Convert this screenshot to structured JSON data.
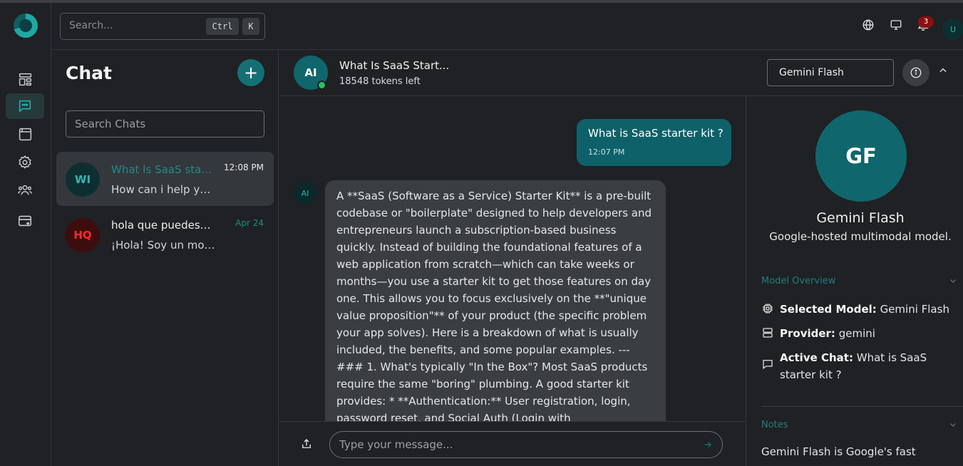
{
  "app": {
    "topbar": {
      "search_placeholder": "Search...",
      "shortcut_ctrl": "Ctrl",
      "shortcut_key": "K",
      "notification_count": "3",
      "user_initial": "U"
    },
    "rail": {
      "icons": [
        "dashboard-icon",
        "chat-icon",
        "browser-icon",
        "settings-icon",
        "users-icon",
        "billing-icon"
      ],
      "active": "chat-icon"
    },
    "chat_list": {
      "title": "Chat",
      "new_chat_label": "+",
      "search_placeholder": "Search Chats",
      "items": [
        {
          "initials": "WI",
          "title": "What Is SaaS starter kit",
          "preview": "How can i help you today?",
          "time": "12:08 PM",
          "avatar_bg": "#0d2f32",
          "avatar_fg": "#2fb7ae",
          "title_color": "#1f8b86",
          "time_color": "#ecedef"
        },
        {
          "initials": "HQ",
          "title": "hola que puedes hacer",
          "preview": "¡Hola! Soy un modelo de lenguaje",
          "time": "Apr 24",
          "avatar_bg": "#3d0d0d",
          "avatar_fg": "#ff2a2a",
          "title_color": "#eceef0",
          "time_color": "#1f8b86"
        }
      ]
    },
    "conversation": {
      "avatar": "AI",
      "title": "What Is SaaS Start...",
      "tokens_left": "18548 tokens left",
      "model_selected": "Gemini Flash",
      "messages": {
        "user": {
          "text": "What is SaaS starter kit ?",
          "time": "12:07 PM"
        },
        "ai_avatar": "AI",
        "ai_text": "A **SaaS (Software as a Service) Starter Kit** is a pre-built codebase or \"boilerplate\" designed to help developers and entrepreneurs launch a subscription-based business quickly. Instead of building the foundational features of a web application from scratch—which can take weeks or months—you use a starter kit to get those features on day one. This allows you to focus exclusively on the **\"unique value proposition\"** of your product (the specific problem your app solves). Here is a breakdown of what is usually included, the benefits, and some popular examples. --- ### 1. What's typically \"In the Box\"? Most SaaS products require the same \"boring\" plumbing. A good starter kit provides: * **Authentication:** User registration, login, password reset, and Social Auth (Login with Google/GitHub)."
      },
      "composer_placeholder": "Type your message..."
    },
    "model_panel": {
      "initials": "GF",
      "name": "Gemini Flash",
      "description": "Google-hosted multimodal model.",
      "overview_title": "Model Overview",
      "selected_model_label": "Selected Model:",
      "selected_model_value": "Gemini Flash",
      "provider_label": "Provider:",
      "provider_value": "gemini",
      "active_chat_label": "Active Chat:",
      "active_chat_value": "What is SaaS starter kit ?",
      "notes_title": "Notes",
      "notes_text": "Gemini Flash is Google's fast"
    },
    "colors": {
      "accent": "#157076",
      "accent_text": "#227d80",
      "background": "#1f2124",
      "panel_selected": "#34373c"
    }
  }
}
